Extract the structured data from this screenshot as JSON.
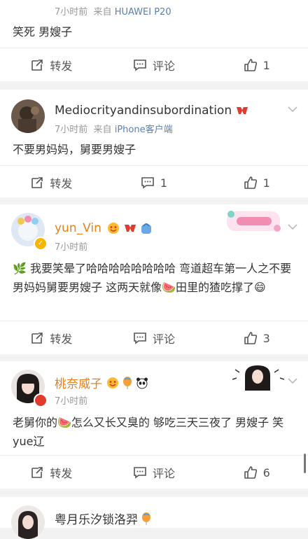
{
  "posts": [
    {
      "meta": {
        "time": "7小时前",
        "via": "来自",
        "source": "HUAWEI P20"
      },
      "text": "笑死 男嫂子",
      "actions": {
        "repost": "转发",
        "comment": "评论",
        "like": "1"
      }
    },
    {
      "name": "Mediocrityandinsubordination",
      "meta": {
        "time": "7小时前",
        "via": "来自",
        "source": "iPhone客户端"
      },
      "text": "不要男妈妈，舅要男嫂子",
      "actions": {
        "repost": "转发",
        "comment": "1",
        "like": "1"
      }
    },
    {
      "name": "yun_Vin",
      "meta": {
        "time": "7小时前"
      },
      "text": "🌿 我要笑晕了哈哈哈哈哈哈哈哈 弯道超车第一人之不要男妈妈舅要男嫂子 这两天就像🍉田里的猹吃撑了😄",
      "actions": {
        "repost": "转发",
        "comment": "评论",
        "like": "3"
      }
    },
    {
      "name": "桃奈威子",
      "meta": {
        "time": "7小时前"
      },
      "text": "老舅你的🍉怎么又长又臭的 够吃三天三夜了 男嫂子 笑yue辽",
      "actions": {
        "repost": "转发",
        "comment": "评论",
        "like": "6"
      }
    },
    {
      "name": "粤月乐汐锁洛羿"
    }
  ],
  "icons": {
    "repost": "repost-icon",
    "comment": "comment-icon",
    "like": "thumbs-up-icon",
    "chevron": "chevron-down-icon"
  },
  "colors": {
    "name_highlight": "#e8811f",
    "source_link": "#5b7fb0",
    "background": "#f2f2f2"
  }
}
